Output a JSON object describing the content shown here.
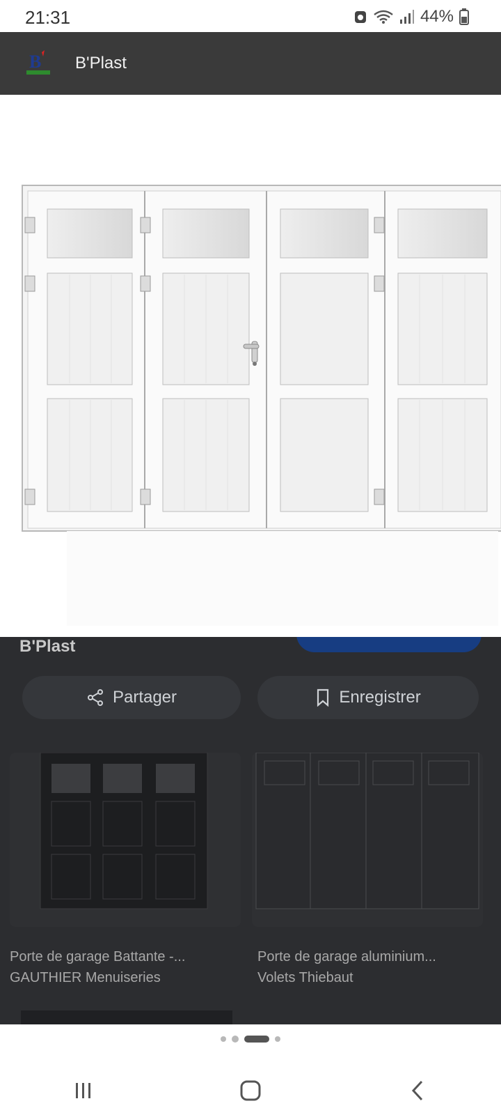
{
  "status_bar": {
    "time": "21:31",
    "battery_percent": "44%"
  },
  "header": {
    "site_name": "B'Plast"
  },
  "preview": {
    "source_label": "B'Plast"
  },
  "actions": {
    "share_label": "Partager",
    "save_label": "Enregistrer"
  },
  "related": [
    {
      "title": "Porte de garage Battante -...",
      "site": "GAUTHIER Menuiseries"
    },
    {
      "title": "Porte de garage aluminium...",
      "site": "Volets Thiebaut"
    }
  ],
  "pager": {
    "count": 4,
    "active_index": 2
  },
  "colors": {
    "header_bg": "#3a3a3a",
    "visit_button": "#173d82",
    "dimmed_bg": "#2c2d30"
  },
  "icons": [
    "wifi-icon",
    "signal-icon",
    "battery-icon",
    "share-icon",
    "bookmark-icon",
    "recents-icon",
    "home-icon",
    "back-icon"
  ]
}
